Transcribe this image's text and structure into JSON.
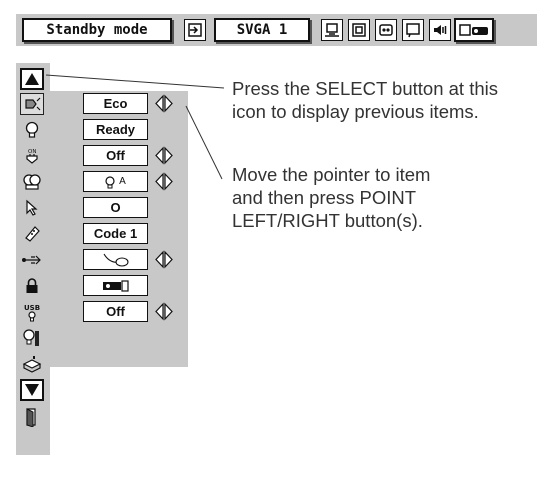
{
  "toolbar": {
    "mode_label": "Standby mode",
    "input_label": "SVGA 1",
    "icons": [
      "input-select-icon",
      "computer-system-icon",
      "screen-size-icon",
      "image-adjust-icon",
      "picture-icon",
      "sound-icon",
      "setting-icon"
    ]
  },
  "left_column": {
    "icons": [
      "up-arrow-icon",
      "lamp-mode-icon",
      "lamp-status-icon",
      "power-management-icon",
      "lamp-counter-icon",
      "pointer-icon",
      "remote-control-icon",
      "mouse-icon",
      "security-lock-icon",
      "usb-icon",
      "lamp-replace-icon",
      "filter-icon",
      "down-arrow-icon",
      "exit-icon"
    ]
  },
  "items": [
    {
      "value": "Eco",
      "adjustable": true
    },
    {
      "value": "Ready",
      "adjustable": false
    },
    {
      "value": "Off",
      "adjustable": true
    },
    {
      "value": "",
      "icon": "auto-lamp-icon",
      "icon_text": "A",
      "adjustable": true
    },
    {
      "value": "O",
      "adjustable": false
    },
    {
      "value": "Code 1",
      "adjustable": false
    },
    {
      "value": "",
      "icon": "mouse-icon",
      "adjustable": true
    },
    {
      "value": "",
      "icon": "projector-icon",
      "adjustable": false
    },
    {
      "value": "Off",
      "adjustable": true
    }
  ],
  "callouts": {
    "select_note_line1": "Press the SELECT button at this",
    "select_note_line2": "icon to display previous items.",
    "pointer_note_line1": "Move the pointer to item",
    "pointer_note_line2": "and then press POINT",
    "pointer_note_line3": "LEFT/RIGHT button(s)."
  },
  "colors": {
    "panel_gray": "#c8c8c8",
    "box_white": "#ffffff",
    "text_dark": "#111111"
  }
}
